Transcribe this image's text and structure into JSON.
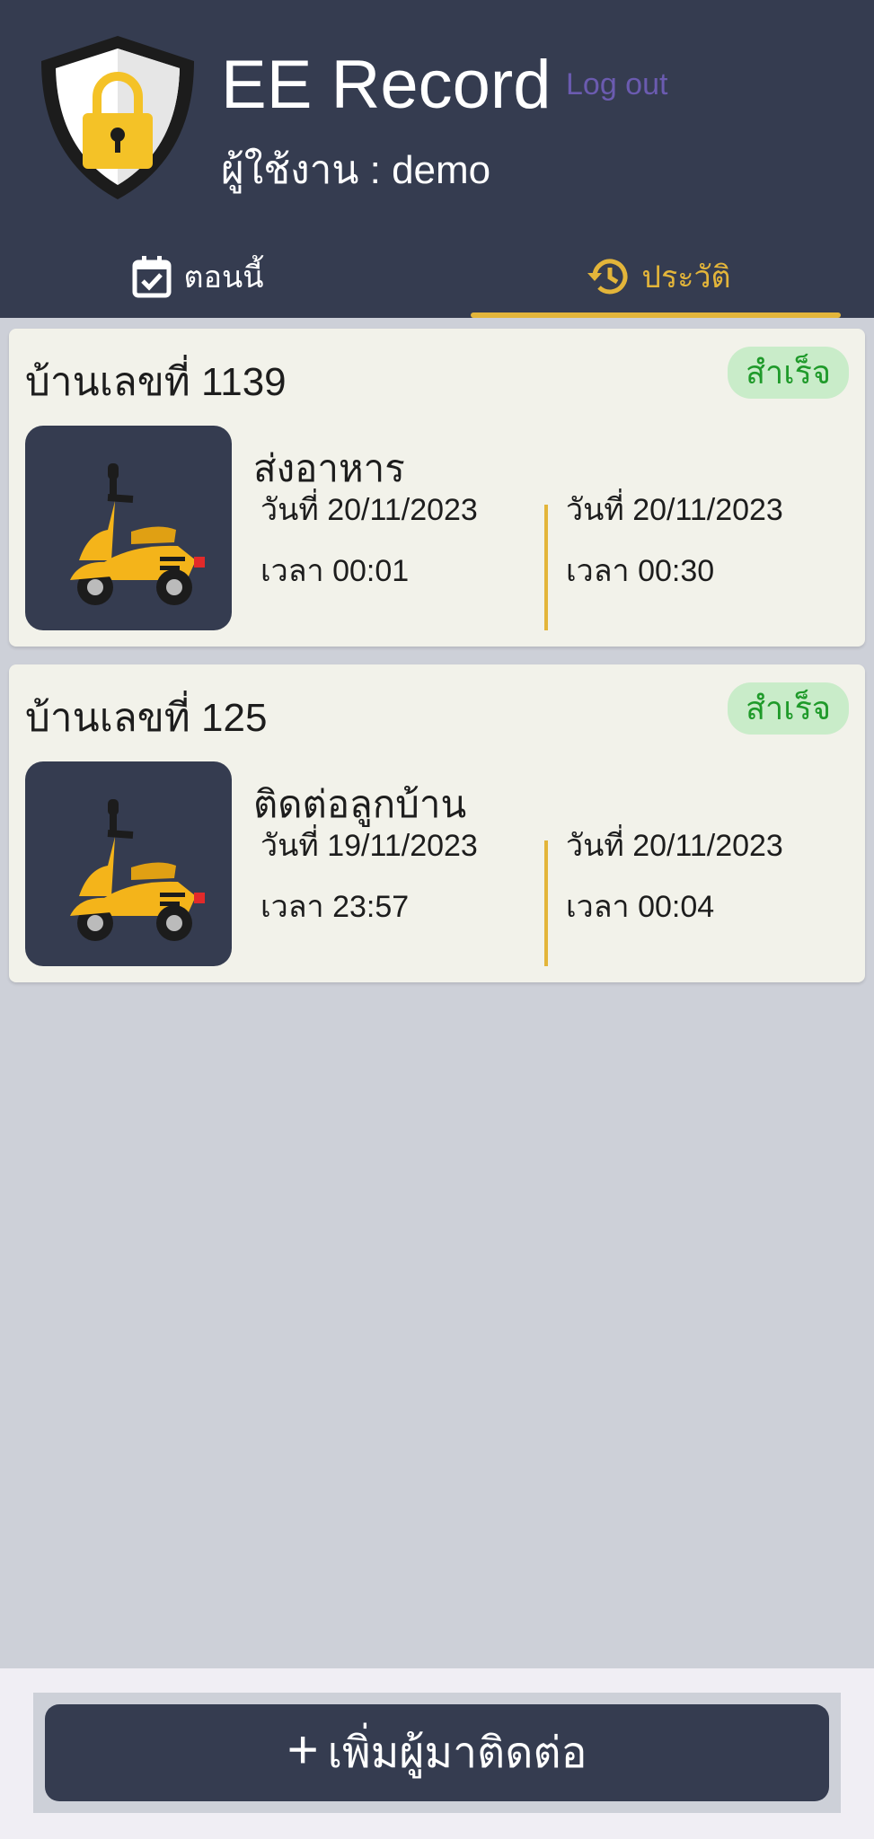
{
  "header": {
    "title": "EE Record",
    "logout_label": "Log out",
    "user_line": "ผู้ใช้งาน : demo"
  },
  "tabs": [
    {
      "label": "ตอนนี้",
      "icon": "calendar-check-icon",
      "active": false
    },
    {
      "label": "ประวัติ",
      "icon": "history-icon",
      "active": true
    }
  ],
  "records": [
    {
      "house": "บ้านเลขที่ 1139",
      "status": "สำเร็จ",
      "service": "ส่งอาหาร",
      "icon": "scooter-icon",
      "start_date": "วันที่ 20/11/2023",
      "start_time": "เวลา 00:01",
      "end_date": "วันที่ 20/11/2023",
      "end_time": "เวลา 00:30"
    },
    {
      "house": "บ้านเลขที่ 125",
      "status": "สำเร็จ",
      "service": "ติดต่อลูกบ้าน",
      "icon": "scooter-icon",
      "start_date": "วันที่ 19/11/2023",
      "start_time": "เวลา 23:57",
      "end_date": "วันที่ 20/11/2023",
      "end_time": "เวลา 00:04"
    }
  ],
  "add_button": {
    "icon": "+",
    "label": "เพิ่มผู้มาติดต่อ"
  },
  "colors": {
    "header_bg": "#353c50",
    "accent": "#e3b53a",
    "logout": "#6b5bb0",
    "success_text": "#1f9a2a",
    "success_bg": "#c9ecc9",
    "page_bg": "#cdd0d8",
    "card_bg": "#f2f2ea"
  }
}
